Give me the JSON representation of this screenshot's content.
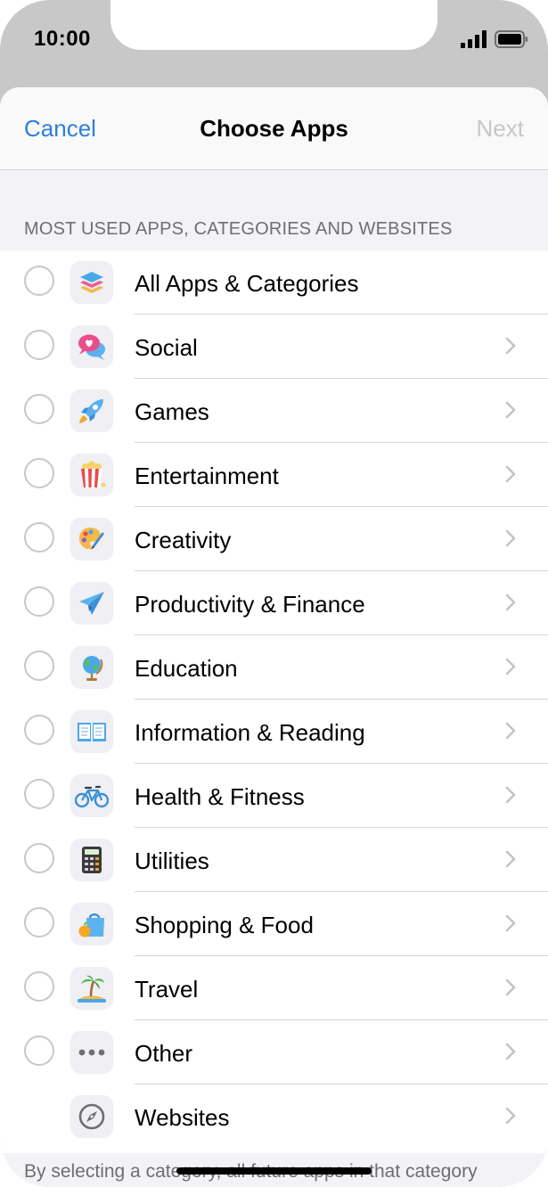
{
  "status_bar": {
    "time": "10:00"
  },
  "nav": {
    "cancel": "Cancel",
    "title": "Choose Apps",
    "next": "Next"
  },
  "section_header": "MOST USED APPS, CATEGORIES AND WEBSITES",
  "categories": [
    {
      "label": "All Apps & Categories",
      "icon": "stack-icon",
      "has_chevron": false
    },
    {
      "label": "Social",
      "icon": "chat-bubbles-icon",
      "has_chevron": true
    },
    {
      "label": "Games",
      "icon": "rocket-icon",
      "has_chevron": true
    },
    {
      "label": "Entertainment",
      "icon": "popcorn-icon",
      "has_chevron": true
    },
    {
      "label": "Creativity",
      "icon": "palette-icon",
      "has_chevron": true
    },
    {
      "label": "Productivity & Finance",
      "icon": "paper-plane-icon",
      "has_chevron": true
    },
    {
      "label": "Education",
      "icon": "globe-icon",
      "has_chevron": true
    },
    {
      "label": "Information & Reading",
      "icon": "book-icon",
      "has_chevron": true
    },
    {
      "label": "Health & Fitness",
      "icon": "bicycle-icon",
      "has_chevron": true
    },
    {
      "label": "Utilities",
      "icon": "calculator-icon",
      "has_chevron": true
    },
    {
      "label": "Shopping & Food",
      "icon": "shopping-bag-icon",
      "has_chevron": true
    },
    {
      "label": "Travel",
      "icon": "palm-tree-icon",
      "has_chevron": true
    },
    {
      "label": "Other",
      "icon": "ellipsis-icon",
      "has_chevron": true
    },
    {
      "label": "Websites",
      "icon": "compass-icon",
      "has_chevron": true
    }
  ],
  "footer_text": "By selecting a category, all future apps in that category",
  "colors": {
    "accent": "#2e7de0",
    "disabled": "#c7c7cc",
    "secondary_text": "#6e6e73",
    "group_background": "#f2f2f7"
  }
}
